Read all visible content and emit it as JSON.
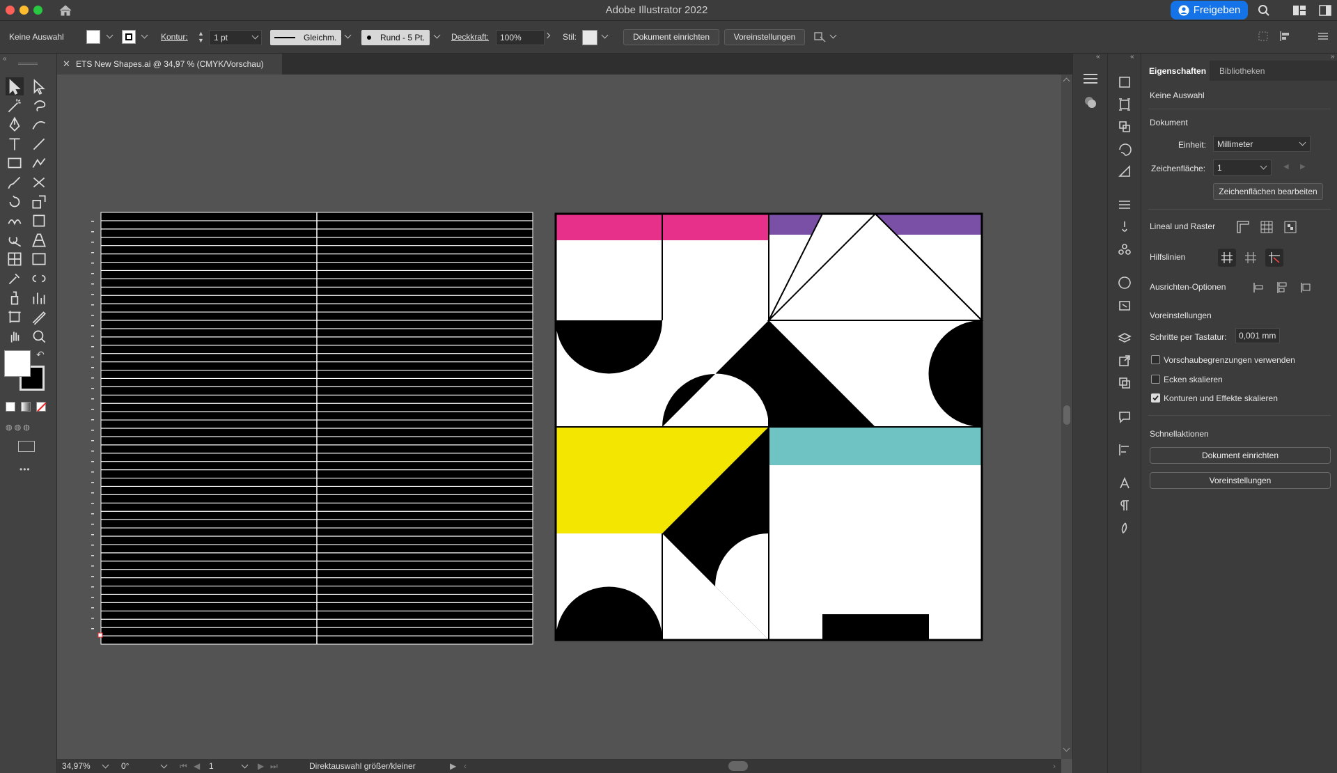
{
  "app": {
    "title": "Adobe Illustrator 2022",
    "share_label": "Freigeben"
  },
  "control_bar": {
    "selection": "Keine Auswahl",
    "stroke_label": "Kontur:",
    "stroke_weight": "1 pt",
    "stroke_profile": "Gleichm.",
    "brush": "Rund - 5 Pt.",
    "opacity_label": "Deckkraft:",
    "opacity_value": "100%",
    "style_label": "Stil:",
    "setup_button": "Dokument einrichten",
    "prefs_button": "Voreinstellungen"
  },
  "document_tab": {
    "title": "ETS New Shapes.ai @ 34,97 % (CMYK/Vorschau)"
  },
  "status_bar": {
    "zoom": "34,97%",
    "rotation": "0°",
    "artboard": "1",
    "status_text": "Direktauswahl größer/kleiner"
  },
  "properties": {
    "tabs": [
      "Eigenschaften",
      "Bibliotheken"
    ],
    "selection": "Keine Auswahl",
    "document_section": "Dokument",
    "unit_label": "Einheit:",
    "unit_value": "Millimeter",
    "artboard_label": "Zeichenfläche:",
    "artboard_value": "1",
    "edit_artboards_button": "Zeichenflächen bearbeiten",
    "rulers_grids": "Lineal und Raster",
    "guides": "Hilfslinien",
    "align_options": "Ausrichten-Optionen",
    "preferences_section": "Voreinstellungen",
    "keyboard_increment_label": "Schritte per Tastatur:",
    "keyboard_increment_value": "0,001 mm",
    "checkboxes": [
      {
        "label": "Vorschaubegrenzungen verwenden",
        "checked": false
      },
      {
        "label": "Ecken skalieren",
        "checked": false
      },
      {
        "label": "Konturen und Effekte skalieren",
        "checked": true
      }
    ],
    "quick_actions": "Schnellaktionen",
    "quick_setup_button": "Dokument einrichten",
    "quick_prefs_button": "Voreinstellungen"
  },
  "colors": {
    "magenta": "#e6308a",
    "purple": "#7a4fa6",
    "yellow": "#f3e600",
    "teal": "#6fc3c3",
    "accent": "#1473e6"
  }
}
